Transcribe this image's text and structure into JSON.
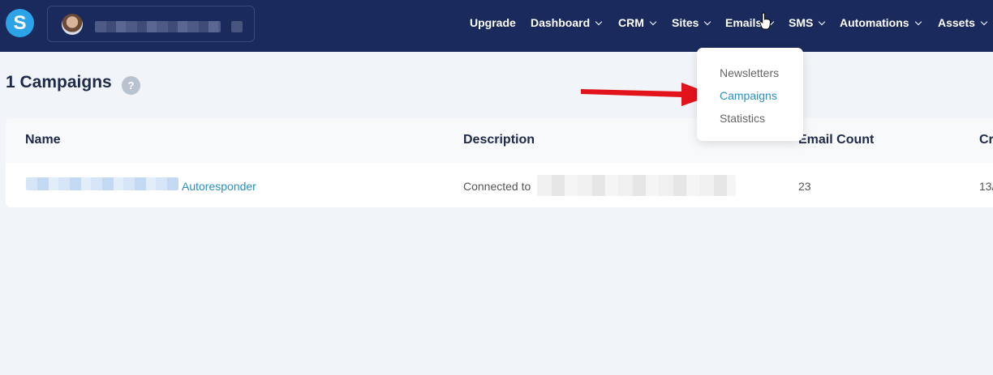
{
  "header": {
    "logo_letter": "S",
    "nav": [
      {
        "label": "Upgrade",
        "dropdown": false
      },
      {
        "label": "Dashboard",
        "dropdown": true
      },
      {
        "label": "CRM",
        "dropdown": true
      },
      {
        "label": "Sites",
        "dropdown": true
      },
      {
        "label": "Emails",
        "dropdown": true
      },
      {
        "label": "SMS",
        "dropdown": true
      },
      {
        "label": "Automations",
        "dropdown": true
      },
      {
        "label": "Assets",
        "dropdown": true
      }
    ]
  },
  "emails_menu": {
    "items": [
      {
        "label": "Newsletters",
        "active": false
      },
      {
        "label": "Campaigns",
        "active": true
      },
      {
        "label": "Statistics",
        "active": false
      }
    ]
  },
  "page": {
    "title": "1 Campaigns",
    "help": "?"
  },
  "table": {
    "columns": [
      "Name",
      "Description",
      "Email Count",
      "Cr"
    ],
    "rows": [
      {
        "name_suffix": "Autoresponder",
        "description": "Connected to",
        "email_count": "23",
        "created": "13/"
      }
    ]
  },
  "colors": {
    "topbar": "#1a2a5c",
    "accent": "#2a8fc0",
    "logo": "#2ba3e6",
    "arrow": "#e3131b"
  },
  "icons": [
    "logo-icon",
    "avatar",
    "chevron-down-icon",
    "hand-cursor-icon",
    "help-icon",
    "arrow-annotation"
  ]
}
